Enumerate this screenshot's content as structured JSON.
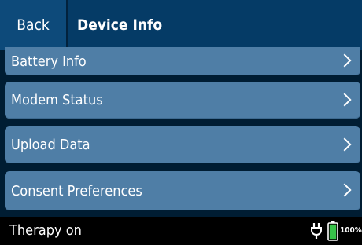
{
  "header": {
    "back_label": "Back",
    "title": "Device Info"
  },
  "menu": {
    "items": [
      {
        "label": "Battery Info"
      },
      {
        "label": "Modem Status"
      },
      {
        "label": "Upload Data"
      },
      {
        "label": "Consent Preferences"
      }
    ]
  },
  "status_bar": {
    "therapy_status": "Therapy on",
    "battery_percent": "100%",
    "power_source_icon": "plug-icon",
    "battery_icon": "battery-full-icon"
  },
  "colors": {
    "header_bg": "#053b66",
    "back_button_bg": "#0d4a7a",
    "menu_item_bg": "#4f7ea6",
    "battery_green": "#37c24a"
  }
}
